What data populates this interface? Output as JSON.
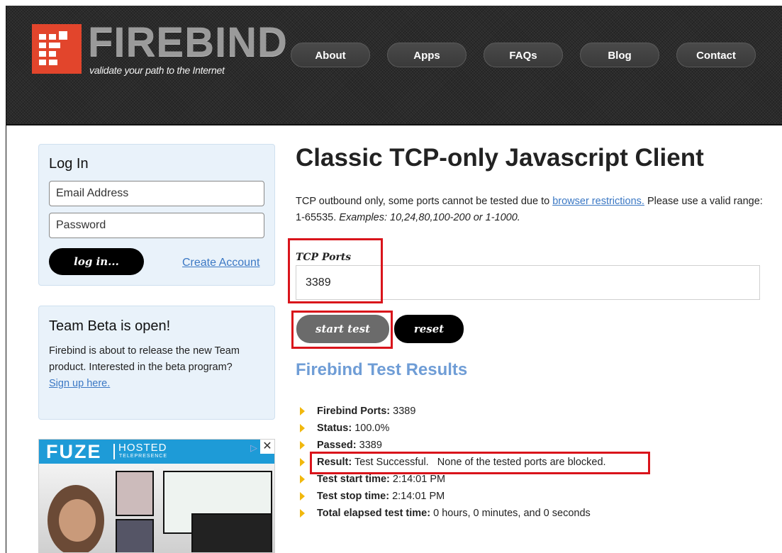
{
  "header": {
    "logo_text": "FIREBIND",
    "tagline": "validate your path to the Internet",
    "nav": [
      "About",
      "Apps",
      "FAQs",
      "Blog",
      "Contact"
    ]
  },
  "login": {
    "title": "Log In",
    "email_placeholder": "Email Address",
    "password_placeholder": "Password",
    "login_button": "log in...",
    "create_account": "Create Account"
  },
  "beta": {
    "title": "Team Beta is open!",
    "body": "Firebind is about to release the new Team product. Interested in the beta program?",
    "link": "Sign up here."
  },
  "ad": {
    "brand": "FUZE",
    "hosted": "HOSTED",
    "telepresence": "TELEPRESENCE",
    "choice_icon": "adchoices-icon",
    "close_icon": "close-icon"
  },
  "main": {
    "title": "Classic TCP-only Javascript Client",
    "intro_before": "TCP outbound only, some ports cannot be tested due to ",
    "intro_link": "browser restrictions.",
    "intro_after": " Please use a valid range: 1-65535. ",
    "intro_examples": "Examples: 10,24,80,100-200 or 1-1000.",
    "ports_label": "TCP Ports",
    "ports_value": "3389",
    "start_button": "start test",
    "reset_button": "reset",
    "results_title": "Firebind Test Results"
  },
  "results": [
    {
      "label": "Firebind Ports:",
      "value": "3389"
    },
    {
      "label": "Status:",
      "value": "100.0%"
    },
    {
      "label": "Passed:",
      "value": "3389"
    },
    {
      "label": "Result:",
      "value": "Test Successful.   None of the tested ports are blocked."
    },
    {
      "label": "Test start time:",
      "value": "2:14:01 PM"
    },
    {
      "label": "Test stop time:",
      "value": "2:14:01 PM"
    },
    {
      "label": "Total elapsed test time:",
      "value": "0 hours, 0 minutes, and 0 seconds"
    }
  ],
  "colors": {
    "brand_red": "#e2452c",
    "link_blue": "#3b78c4",
    "results_blue": "#6f9dd6",
    "highlight_red": "#d9141b",
    "bullet_yellow": "#f1b80d"
  }
}
